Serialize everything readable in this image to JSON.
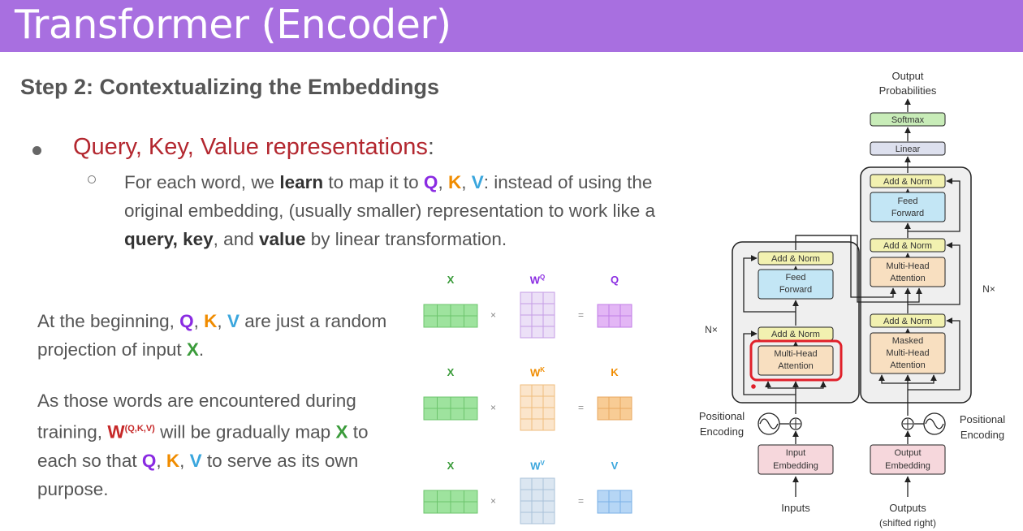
{
  "title": "Transformer (Encoder)",
  "step_heading": "Step 2: Contextualizing the Embeddings",
  "bullet": {
    "heading": "Query, Key, Value representations",
    "heading_colon": ":",
    "sub": {
      "t1": "For each word, we ",
      "learn": "learn",
      "t2": " to map it to ",
      "Q": "Q",
      "c1": ", ",
      "K": "K",
      "c2": ", ",
      "V": "V",
      "t3": ": instead of using the original embedding, (usually smaller) representation to work like a ",
      "query": "query,",
      "sp": " ",
      "key": "key",
      "t4": ", and ",
      "value": "value",
      "t5": " by linear transformation."
    }
  },
  "para1": {
    "t1": "At the beginning, ",
    "Q": "Q",
    "c1": ", ",
    "K": "K",
    "c2": ", ",
    "V": "V",
    "t2": " are just a random projection of input ",
    "X": "X",
    "t3": "."
  },
  "para2": {
    "t1": "As those words are encountered during training, ",
    "W": "W",
    "sup": "(Q,K,V)",
    "t2": " will be gradually map ",
    "X": "X",
    "t3": " to each so that ",
    "Q": "Q",
    "c1": ", ",
    "K": "K",
    "c2": ", ",
    "V": "V",
    "t4": " to serve as its own purpose."
  },
  "matrices": {
    "row_q": {
      "x": "X",
      "w": "W",
      "w_sup": "Q",
      "out": "Q",
      "times": "×",
      "eq": "="
    },
    "row_k": {
      "x": "X",
      "w": "W",
      "w_sup": "K",
      "out": "K",
      "times": "×",
      "eq": "="
    },
    "row_v": {
      "x": "X",
      "w": "W",
      "w_sup": "V",
      "out": "V",
      "times": "×",
      "eq": "="
    }
  },
  "colors": {
    "title_bar": "#a86fe0",
    "x_green": "#3a9b3a",
    "query_purple": "#8a2be2",
    "key_orange": "#f08c00",
    "value_blue": "#3aa6dd",
    "highlight_red": "#e0202a"
  },
  "diagram": {
    "output_probabilities": [
      "Output",
      "Probabilities"
    ],
    "softmax": "Softmax",
    "linear": "Linear",
    "add_norm": "Add & Norm",
    "feed_forward": [
      "Feed",
      "Forward"
    ],
    "multi_head_attention": [
      "Multi-Head",
      "Attention"
    ],
    "masked_multi_head_attention": [
      "Masked",
      "Multi-Head",
      "Attention"
    ],
    "nx_left": "N×",
    "nx_right": "N×",
    "positional_encoding": [
      "Positional",
      "Encoding"
    ],
    "input_embedding": [
      "Input",
      "Embedding"
    ],
    "output_embedding": [
      "Output",
      "Embedding"
    ],
    "inputs": "Inputs",
    "outputs": [
      "Outputs",
      "(shifted right)"
    ]
  }
}
